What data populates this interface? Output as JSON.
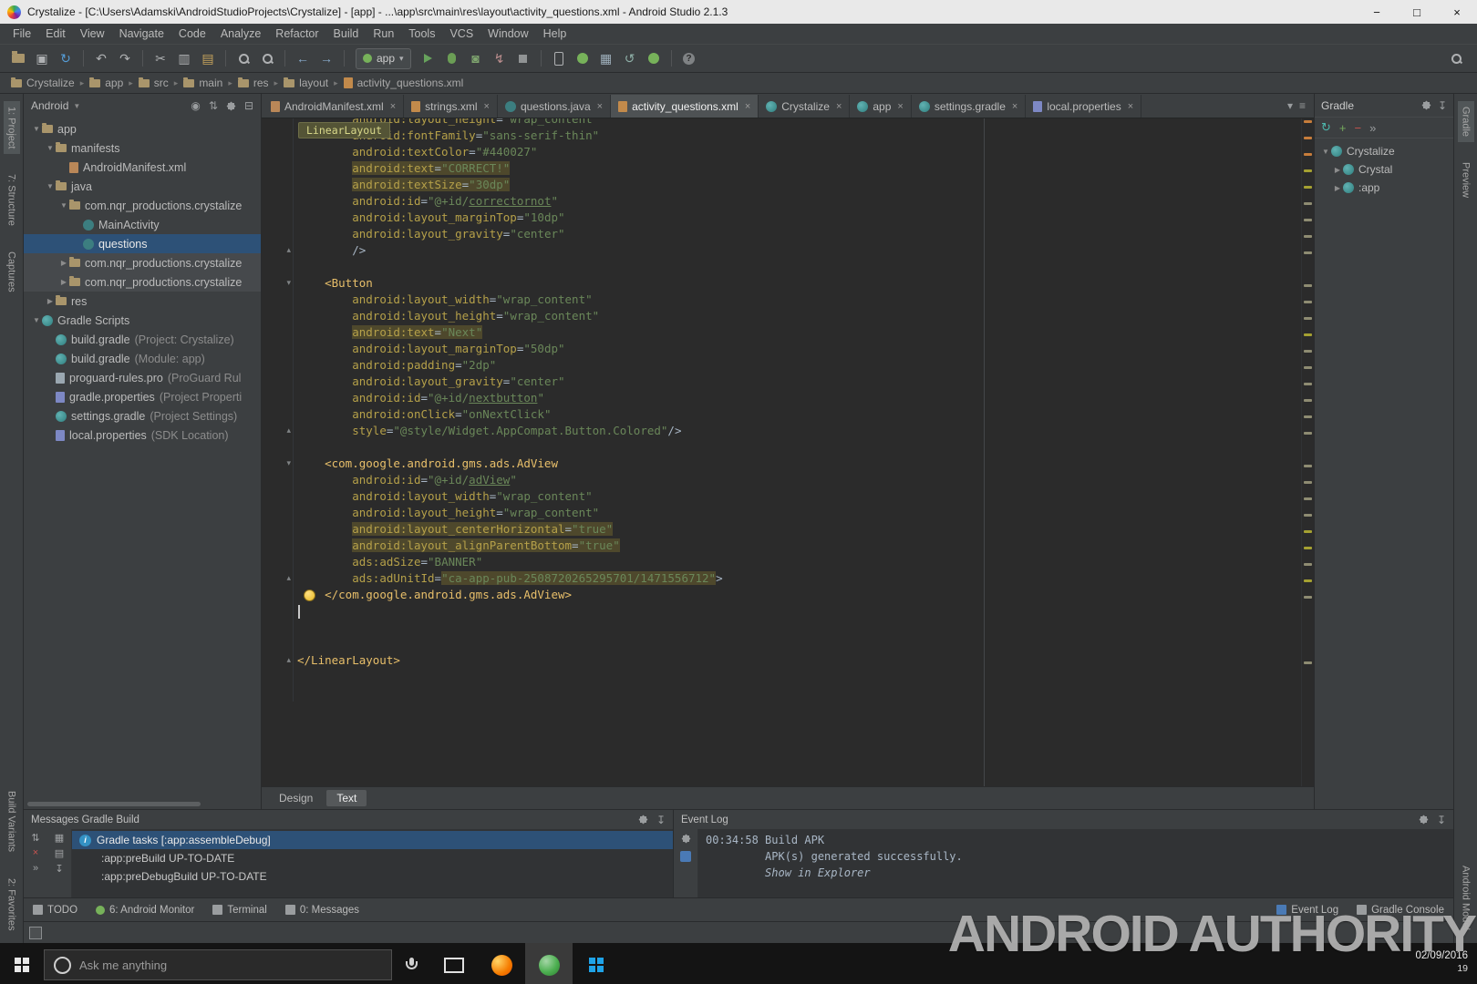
{
  "window": {
    "title": "Crystalize - [C:\\Users\\Adamski\\AndroidStudioProjects\\Crystalize] - [app] - ...\\app\\src\\main\\res\\layout\\activity_questions.xml - Android Studio 2.1.3",
    "controls": {
      "minimize": "−",
      "maximize": "□",
      "close": "×"
    }
  },
  "menu": {
    "items": [
      "File",
      "Edit",
      "View",
      "Navigate",
      "Code",
      "Analyze",
      "Refactor",
      "Build",
      "Run",
      "Tools",
      "VCS",
      "Window",
      "Help"
    ]
  },
  "toolbar": {
    "run_config": "app",
    "items": [
      {
        "name": "open-icon",
        "kind": "css",
        "cls": "ic-folder-big"
      },
      {
        "name": "save-all-icon",
        "kind": "glyph",
        "glyph": "▣",
        "color": "#AFB1B3"
      },
      {
        "name": "sync-icon",
        "kind": "glyph",
        "glyph": "↻",
        "color": "#559CD6"
      },
      {
        "name": "sep"
      },
      {
        "name": "undo-icon",
        "kind": "glyph",
        "glyph": "↶",
        "color": "#AFB1B3"
      },
      {
        "name": "redo-icon",
        "kind": "glyph",
        "glyph": "↷",
        "color": "#AFB1B3"
      },
      {
        "name": "sep"
      },
      {
        "name": "cut-icon",
        "kind": "glyph",
        "glyph": "✂",
        "color": "#AFB1B3"
      },
      {
        "name": "copy-icon",
        "kind": "glyph",
        "glyph": "▥",
        "color": "#AFB1B3"
      },
      {
        "name": "paste-icon",
        "kind": "glyph",
        "glyph": "▤",
        "color": "#C7A35C"
      },
      {
        "name": "sep"
      },
      {
        "name": "find-icon",
        "kind": "css",
        "cls": "ic-mag"
      },
      {
        "name": "find-in-path-icon",
        "kind": "css",
        "cls": "ic-mag"
      },
      {
        "name": "sep"
      },
      {
        "name": "back-icon",
        "kind": "glyph",
        "glyph": "←",
        "color": "#88AACB"
      },
      {
        "name": "forward-icon",
        "kind": "glyph",
        "glyph": "→",
        "color": "#88AACB"
      },
      {
        "name": "sep"
      },
      {
        "name": "run-config-combo",
        "kind": "combo"
      },
      {
        "name": "run-icon",
        "kind": "css",
        "cls": "ic-run"
      },
      {
        "name": "debug-icon",
        "kind": "css",
        "cls": "ic-bug"
      },
      {
        "name": "coverage-icon",
        "kind": "glyph",
        "glyph": "◙",
        "color": "#7FA56F"
      },
      {
        "name": "attach-debugger-icon",
        "kind": "glyph",
        "glyph": "↯",
        "color": "#BD8F8F"
      },
      {
        "name": "stop-icon",
        "kind": "css",
        "cls": "ic-stop"
      },
      {
        "name": "sep"
      },
      {
        "name": "avd-manager-icon",
        "kind": "css",
        "cls": "ic-phone"
      },
      {
        "name": "sdk-manager-icon",
        "kind": "css",
        "cls": "ic-droid"
      },
      {
        "name": "android-monitor-icon",
        "kind": "glyph",
        "glyph": "▦",
        "color": "#9FB0BC"
      },
      {
        "name": "gradle-sync-icon",
        "kind": "glyph",
        "glyph": "↺",
        "color": "#8FB0A8"
      },
      {
        "name": "layout-inspector-icon",
        "kind": "css",
        "cls": "ic-droid"
      },
      {
        "name": "sep"
      },
      {
        "name": "help-icon",
        "kind": "css",
        "cls": "ic-help",
        "glyph": "?"
      }
    ]
  },
  "breadcrumbs": [
    "Crystalize",
    "app",
    "src",
    "main",
    "res",
    "layout",
    "activity_questions.xml"
  ],
  "stripes": {
    "left_top": [
      {
        "label": "1: Project",
        "active": true
      },
      {
        "label": "7: Structure"
      },
      {
        "label": "Captures"
      }
    ],
    "left_bottom": [
      {
        "label": "Build Variants"
      },
      {
        "label": "2: Favorites"
      }
    ],
    "right_top": [
      {
        "label": "Gradle",
        "active": true
      },
      {
        "label": "Preview"
      }
    ],
    "right_bottom": [
      {
        "label": "Android Model"
      }
    ]
  },
  "project": {
    "view_mode": "Android",
    "tree": [
      {
        "level": 0,
        "arrow": "down",
        "icon": "folder",
        "label": "app"
      },
      {
        "level": 1,
        "arrow": "down",
        "icon": "folder",
        "label": "manifests"
      },
      {
        "level": 2,
        "icon": "manifest",
        "label": "AndroidManifest.xml"
      },
      {
        "level": 1,
        "arrow": "down",
        "icon": "folder",
        "label": "java"
      },
      {
        "level": 2,
        "arrow": "down",
        "icon": "package",
        "label": "com.nqr_productions.crystalize"
      },
      {
        "level": 3,
        "icon": "class",
        "label": "MainActivity"
      },
      {
        "level": 3,
        "icon": "class",
        "label": "questions",
        "selected": true
      },
      {
        "level": 2,
        "arrow": "right",
        "icon": "package",
        "label": "com.nqr_productions.crystalize",
        "band": true
      },
      {
        "level": 2,
        "arrow": "right",
        "icon": "package",
        "label": "com.nqr_productions.crystalize",
        "band": true
      },
      {
        "level": 1,
        "arrow": "right",
        "icon": "folder",
        "label": "res"
      },
      {
        "level": 0,
        "arrow": "down",
        "icon": "gradle",
        "label": "Gradle Scripts"
      },
      {
        "level": 1,
        "icon": "gradle",
        "label": "build.gradle",
        "suffix": "(Project: Crystalize)"
      },
      {
        "level": 1,
        "icon": "gradle",
        "label": "build.gradle",
        "suffix": "(Module: app)"
      },
      {
        "level": 1,
        "icon": "textfile",
        "label": "proguard-rules.pro",
        "suffix": "(ProGuard Rul"
      },
      {
        "level": 1,
        "icon": "props",
        "label": "gradle.properties",
        "suffix": "(Project Properti"
      },
      {
        "level": 1,
        "icon": "gradle",
        "label": "settings.gradle",
        "suffix": "(Project Settings)"
      },
      {
        "level": 1,
        "icon": "props",
        "label": "local.properties",
        "suffix": "(SDK Location)"
      }
    ]
  },
  "editor": {
    "context_tag": "LinearLayout",
    "design_tab": "Design",
    "text_tab": "Text",
    "tabs": [
      {
        "icon": "manifest",
        "label": "AndroidManifest.xml"
      },
      {
        "icon": "xml",
        "label": "strings.xml"
      },
      {
        "icon": "java",
        "label": "questions.java"
      },
      {
        "icon": "xml",
        "label": "activity_questions.xml",
        "active": true
      },
      {
        "icon": "gradle",
        "label": "Crystalize"
      },
      {
        "icon": "gradle",
        "label": "app"
      },
      {
        "icon": "gradle",
        "label": "settings.gradle"
      },
      {
        "icon": "props",
        "label": "local.properties"
      }
    ],
    "code": [
      {
        "t": "attr",
        "ind": 8,
        "n": "android:layout_height",
        "v": "wrap_content"
      },
      {
        "t": "attr",
        "ind": 8,
        "n": "android:fontFamily",
        "v": "sans-serif-thin"
      },
      {
        "t": "attr",
        "ind": 8,
        "n": "android:textColor",
        "v": "#440027"
      },
      {
        "t": "attr",
        "ind": 8,
        "n": "android:text",
        "v": "CORRECT!",
        "hl": "line"
      },
      {
        "t": "attr",
        "ind": 8,
        "n": "android:textSize",
        "v": "30dp",
        "hl": "line"
      },
      {
        "t": "attr",
        "ind": 8,
        "n": "android:id",
        "v": "@+id/correctornot"
      },
      {
        "t": "attr",
        "ind": 8,
        "n": "android:layout_marginTop",
        "v": "10dp"
      },
      {
        "t": "attr",
        "ind": 8,
        "n": "android:layout_gravity",
        "v": "center"
      },
      {
        "t": "plain",
        "ind": 8,
        "text": "/>",
        "fold": "end"
      },
      {
        "t": "blank"
      },
      {
        "t": "tag",
        "ind": 4,
        "text": "<Button",
        "fold": "start"
      },
      {
        "t": "attr",
        "ind": 8,
        "n": "android:layout_width",
        "v": "wrap_content"
      },
      {
        "t": "attr",
        "ind": 8,
        "n": "android:layout_height",
        "v": "wrap_content"
      },
      {
        "t": "attr",
        "ind": 8,
        "n": "android:text",
        "v": "Next",
        "hl": "line"
      },
      {
        "t": "attr",
        "ind": 8,
        "n": "android:layout_marginTop",
        "v": "50dp"
      },
      {
        "t": "attr",
        "ind": 8,
        "n": "android:padding",
        "v": "2dp"
      },
      {
        "t": "attr",
        "ind": 8,
        "n": "android:layout_gravity",
        "v": "center"
      },
      {
        "t": "attr",
        "ind": 8,
        "n": "android:id",
        "v": "@+id/nextbutton"
      },
      {
        "t": "attr",
        "ind": 8,
        "n": "android:onClick",
        "v": "onNextClick"
      },
      {
        "t": "attr",
        "ind": 8,
        "n": "style",
        "v": "@style/Widget.AppCompat.Button.Colored",
        "suf": "/>",
        "fold": "end"
      },
      {
        "t": "blank"
      },
      {
        "t": "tag",
        "ind": 4,
        "text": "<com.google.android.gms.ads.AdView",
        "fold": "start"
      },
      {
        "t": "attr",
        "ind": 8,
        "n": "android:id",
        "v": "@+id/adView"
      },
      {
        "t": "attr",
        "ind": 8,
        "n": "android:layout_width",
        "v": "wrap_content"
      },
      {
        "t": "attr",
        "ind": 8,
        "n": "android:layout_height",
        "v": "wrap_content"
      },
      {
        "t": "attr",
        "ind": 8,
        "n": "android:layout_centerHorizontal",
        "v": "true",
        "hl": "line"
      },
      {
        "t": "attr",
        "ind": 8,
        "n": "android:layout_alignParentBottom",
        "v": "true",
        "hl": "line"
      },
      {
        "t": "attr",
        "ind": 8,
        "n": "ads:adSize",
        "v": "BANNER"
      },
      {
        "t": "attr",
        "ind": 8,
        "n": "ads:adUnitId",
        "v": "ca-app-pub-2508720265295701/1471556712",
        "suf": ">",
        "hl": "value",
        "fold": "end"
      },
      {
        "t": "tag",
        "ind": 4,
        "text": "</com.google.android.gms.ads.AdView>",
        "bulb": true
      },
      {
        "t": "blank",
        "caret": true
      },
      {
        "t": "blank"
      },
      {
        "t": "blank"
      },
      {
        "t": "tag",
        "ind": 0,
        "text": "</LinearLayout>",
        "fold": "end"
      },
      {
        "t": "blank"
      },
      {
        "t": "blank"
      }
    ],
    "mark_colors": {
      "default": "#8E8C72",
      "highlight": "#A5A132",
      "warning": "#C77D3B"
    }
  },
  "gradle_panel": {
    "title": "Gradle",
    "tree": [
      {
        "level": 0,
        "arrow": "down",
        "label": "Crystalize"
      },
      {
        "level": 1,
        "arrow": "right",
        "label": "Crystal"
      },
      {
        "level": 1,
        "arrow": "right",
        "label": ":app"
      }
    ]
  },
  "messages": {
    "title": "Messages Gradle Build",
    "rows": [
      "Gradle tasks [:app:assembleDebug]",
      ":app:preBuild UP-TO-DATE",
      ":app:preDebugBuild UP-TO-DATE"
    ]
  },
  "eventlog": {
    "title": "Event Log",
    "lines": [
      {
        "text": "00:34:58 Build APK"
      },
      {
        "text": "         APK(s) generated successfully."
      },
      {
        "text": "         Show in Explorer",
        "italic": true
      }
    ]
  },
  "toolwindows": {
    "left": [
      {
        "icon": "square",
        "label": "TODO"
      },
      {
        "icon": "android",
        "label": "6: Android Monitor"
      },
      {
        "icon": "square",
        "label": "Terminal"
      },
      {
        "icon": "square",
        "label": "0: Messages"
      }
    ],
    "right": [
      {
        "icon": "blue",
        "label": "Event Log"
      },
      {
        "icon": "square",
        "label": "Gradle Console"
      }
    ]
  },
  "taskbar": {
    "search_placeholder": "Ask me anything",
    "date": "02/09/2016",
    "badge": "19"
  },
  "watermark": {
    "text": "ANDROID AUTHORITY"
  }
}
